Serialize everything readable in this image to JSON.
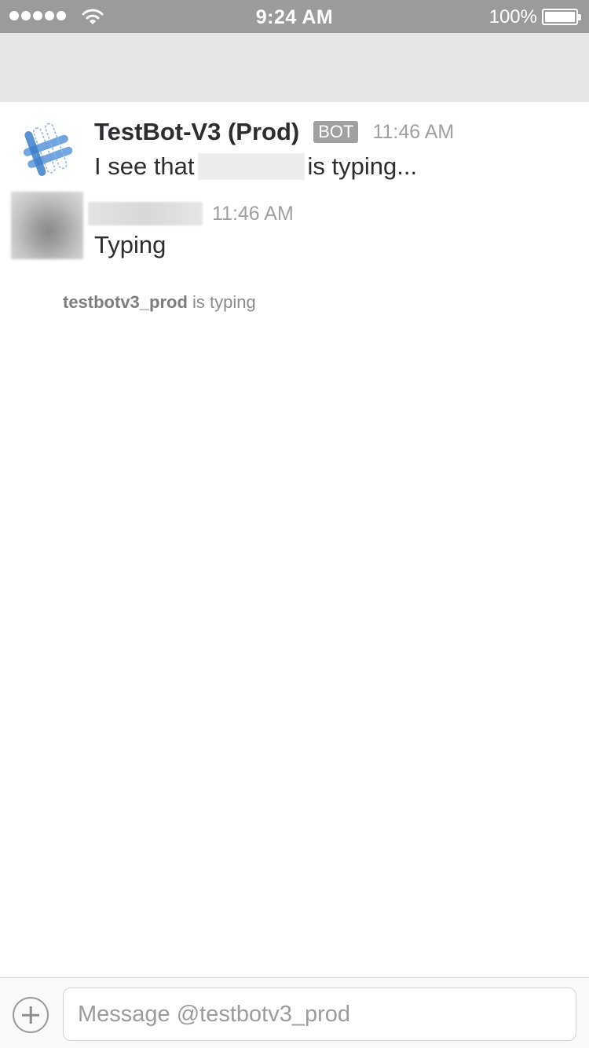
{
  "status_bar": {
    "time": "9:24 AM",
    "battery_percent": "100%",
    "signal_bars": 5,
    "icons": [
      "signal-dots-icon",
      "wifi-icon",
      "battery-icon"
    ]
  },
  "messages": [
    {
      "sender": "TestBot-V3 (Prod)",
      "badge": "BOT",
      "time": "11:46 AM",
      "text_before": "I see that",
      "text_after": "is typing..."
    },
    {
      "time": "11:46 AM",
      "text": "Typing"
    }
  ],
  "typing_indicator": {
    "user": "testbotv3_prod",
    "suffix": " is typing"
  },
  "composer": {
    "placeholder": "Message @testbotv3_prod",
    "value": "",
    "attach_icon": "plus-circle-icon"
  },
  "colors": {
    "status_bar": "#9b9b9b",
    "header_band": "#e5e5e5",
    "badge": "#a0a0a0",
    "timestamp": "#a0a0a0",
    "bot_logo_blue": "#3d7ec9",
    "bot_logo_light_blue": "#8cb8e6"
  }
}
